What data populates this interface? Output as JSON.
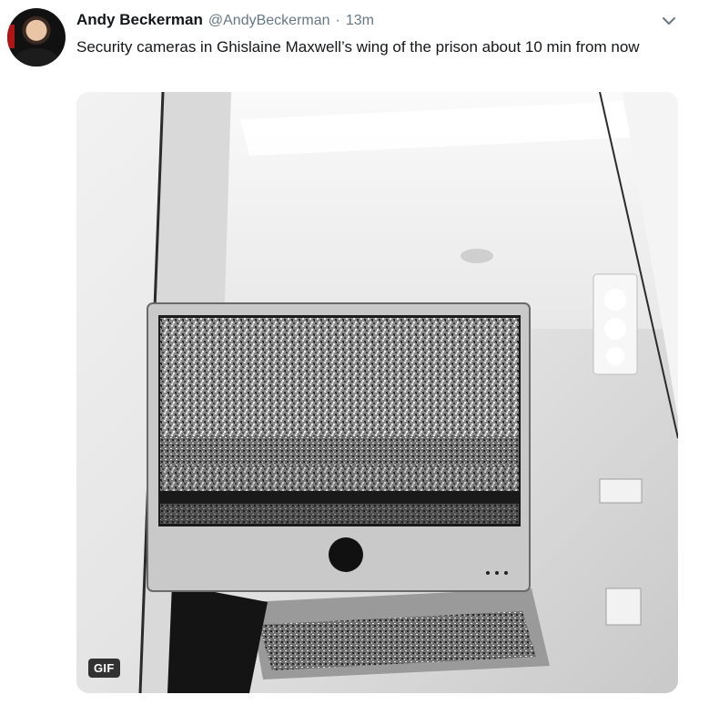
{
  "author": {
    "name": "Andy Beckerman",
    "handle": "@AndyBeckerman",
    "separator": "·",
    "time": "13m"
  },
  "tweet": {
    "text": "Security cameras in Ghislaine Maxwell’s wing of the prison about 10 min from now"
  },
  "media": {
    "badge": "GIF"
  },
  "icons": {
    "menu": "chevron-down-icon"
  },
  "colors": {
    "name": "#14171a",
    "secondary": "#657786",
    "gif_badge_bg": "#000000"
  }
}
